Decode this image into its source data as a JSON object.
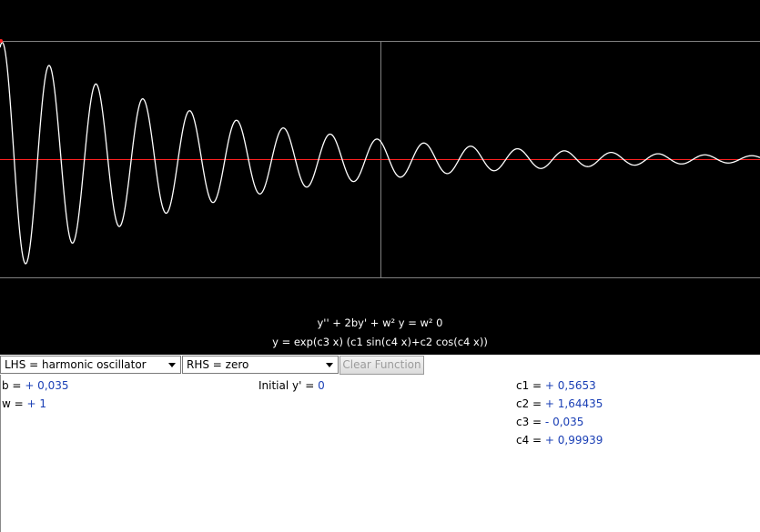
{
  "plot": {
    "background": "#000000",
    "curve_color": "#ffffff",
    "axis_color": "#ff2020",
    "frame_color": "#808080",
    "curve": {
      "function": "y = exp(c3 x) (c1 sin(c4 x)+c2 cos(c4 x))",
      "c1": 0.5653,
      "c2": 1.64435,
      "c3": -0.035,
      "c4": 0.99939,
      "x_range": [
        0,
        102
      ]
    }
  },
  "equations": {
    "ode": "y'' + 2by' + w² y = w² 0",
    "solution": "y = exp(c3 x) (c1 sin(c4 x)+c2 cos(c4 x))"
  },
  "controls": {
    "lhs_label": "LHS = harmonic oscillator",
    "rhs_label": "RHS = zero",
    "clear_label": "Clear Function"
  },
  "params": {
    "b_label": "b = ",
    "b_value": "+ 0,035",
    "w_label": "w = ",
    "w_value": "+ 1",
    "initial_label": "Initial y' = ",
    "initial_value": "0",
    "c1_label": "c1 = ",
    "c1_value": "+ 0,5653",
    "c2_label": "c2 = ",
    "c2_value": "+ 1,64435",
    "c3_label": "c3 = ",
    "c3_value": "-  0,035",
    "c4_label": "c4 = ",
    "c4_value": "+ 0,99939"
  }
}
